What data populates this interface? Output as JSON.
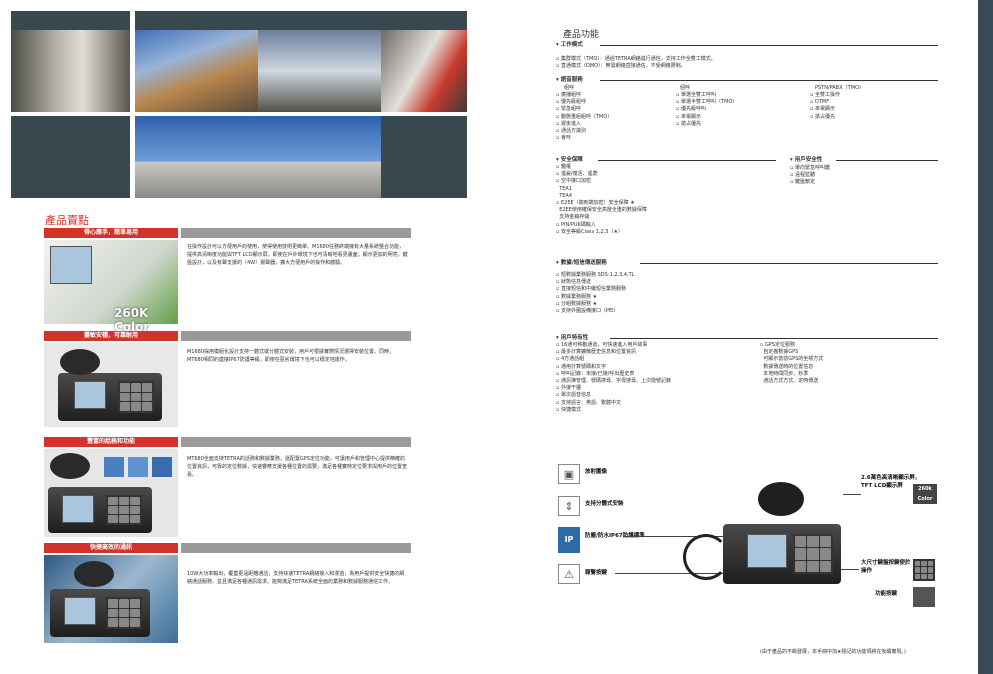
{
  "left": {
    "section_title": "產品賣點",
    "bars": [
      {
        "label": "得心應手，簡單易用"
      },
      {
        "label": "靈敏安穩，可靠耐用"
      },
      {
        "label": "豐富的話務和功能"
      },
      {
        "label": "快捷高效的通訊"
      }
    ],
    "paragraphs": [
      "在操作設計可以方便用戶的使用，使得使用技術更簡單。M1680任務終端擁有大量系統整合功能，提供高清晰度功能與TFT LCD顯示屏，即使在戶外環境下也可清晰地看見畫面；顯示更加的明亮，鍵盤設計，以及有聲支援的（4W）揚聲器，擴大方便用戶的操作和體驗。",
      "M1680採用模組化設計支持一體式或分體式安裝，用戶可根據實際情況選擇安裝位置。同時，MT680相同的連接IP67防護等級，即使在惡劣環境下也可以穩定地運作。",
      "MT680全面支持TETRA的話務和數據業務，還配置GPS定位功能，可讓用戶和管理中心提供精確的位置資訊，可靠的定位數據，快速響應支援各種位置的需要，滿足各種實時定位要求與用戶的位置查看。",
      "10W大功率輸出，覆蓋更遠距離通話；支持快速TETRA網絡接入和漫遊；為用戶提供安全快捷的網絡通話服務，並且滿足各種通訊需求。能夠滿足TETRA系統全面的業務和數據服務通信工作。"
    ],
    "badge_260k": "260K Color",
    "badge_ip": "IP 67"
  },
  "right": {
    "section_title": "產品功能",
    "work_mode": {
      "title": "工作模式",
      "items": [
        "集群模式（TMO）：通過TETRA網絡進行通信，支持工作全雙工模式。",
        "直通模式（DMO）：無需網絡直接通信，不受網絡限制。"
      ]
    },
    "call_services": {
      "title": "語音服務",
      "col_titles": [
        "組呼",
        "個呼",
        "PSTN/PABX（TMO）"
      ],
      "col1": [
        "廣播組呼",
        "優先級組呼",
        "緊急組呼",
        "動態重組組呼（TMO）",
        "遲後進入",
        "通話方識別",
        "會呼"
      ],
      "col2": [
        "單選全雙工呼叫",
        "單選半雙工呼叫（TMO）",
        "優先級呼叫",
        "來電顯示",
        "搶占優先"
      ],
      "col3": [
        "全雙工操作",
        "DTMF",
        "來電顯示",
        "搶占優先"
      ]
    },
    "security": {
      "title": "安全保障",
      "items": [
        "鑑權",
        "遙毙/復活、遙斃",
        "空中接口加密",
        "TEA1",
        "TEA4",
        "E2EE（端到端加密）安全保障 ★",
        "E2EE使用確保安全高度全重的數據保障",
        "支持金鑰存儲",
        "PIN/PUK碼輸入",
        "安全等級Class 1,2,3（★）"
      ],
      "user_title": "用戶安全性",
      "user_items": [
        "單向緊急呼叫鍵",
        "遠程監聽",
        "鍵盤鎖定"
      ]
    },
    "data": {
      "title": "數據/短信傳送服務",
      "items": [
        "短數據業務服務 SDS-1,2,3,4,TL",
        "狀態信息傳送",
        "直接短信和中繼短信業務服務",
        "數據業務服務 ★",
        "分組數據服務 ★",
        "支持外圍設備接口（PEI）"
      ]
    },
    "user_features": {
      "title": "用戶特有性",
      "col1": [
        "16通可移動通道，可快速進入用戶故事",
        "最多計算擴散歷史信息和位置資訊",
        "4方通話組",
        "通用計算號碼和文字",
        "呼叫記錄：未接/已接/呼出歷史表",
        "通訊簿管理、號碼搜尋、字母搜尋、上次撥號記錄",
        "外接干擾",
        "單次語音信息",
        "支持語言：英語、繁體中文",
        "快捷模式"
      ],
      "col2": [
        "GPS定位服務",
        "自定義數據GPS",
        "可顯示當前GPS的坐標方式",
        "數據傳送時的位置信息",
        "本地時間同步、秒準",
        "通話方式方式、定時傳送"
      ]
    },
    "callouts": {
      "left": [
        "放射圖像",
        "支持分體式安裝",
        "防塵/防水IP67防護標準",
        "報警按鍵"
      ],
      "right": [
        "2.6萬色高清晰顯示屏，TFT LCD顯示屏",
        "大尺寸鍵盤按鍵便於操作",
        "功能按鍵"
      ]
    },
    "badge_260k_small": "260k Color",
    "footnote": "(由于產品的不斷發展，本手冊中加★標記的功能項將在後續實現。)"
  }
}
